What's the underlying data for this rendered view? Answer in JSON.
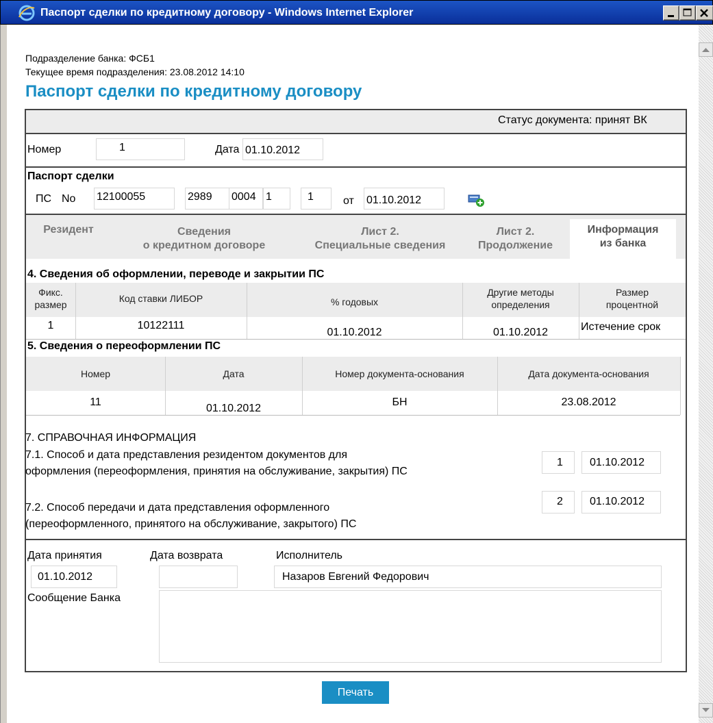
{
  "window": {
    "title": "Паспорт сделки по кредитному договору - Windows Internet Explorer"
  },
  "header": {
    "branch": "Подразделение банка: ФСБ1",
    "time": "Текущее время подразделения: 23.08.2012 14:10",
    "page_title": "Паспорт сделки по кредитному договору"
  },
  "status": "Статус документа: принят ВК",
  "doc": {
    "number_label": "Номер",
    "number": "1",
    "date_label": "Дата",
    "date": "01.10.2012"
  },
  "ps": {
    "heading": "Паспорт сделки",
    "ps_label": "ПС",
    "no_label": "No",
    "part1": "12100055",
    "part2": "2989",
    "part3": "0004",
    "part4": "1",
    "part5": "1",
    "from_label": "от",
    "date": "01.10.2012"
  },
  "tabs": [
    {
      "line1": "Резидент",
      "line2": ""
    },
    {
      "line1": "Сведения",
      "line2": "о кредитном договоре"
    },
    {
      "line1": "Лист 2.",
      "line2": "Специальные сведения"
    },
    {
      "line1": "Лист 2.",
      "line2": "Продолжение"
    },
    {
      "line1": "Информация",
      "line2": "из банка"
    }
  ],
  "section4": {
    "heading": "4. Сведения об оформлении, переводе и закрытии ПС",
    "headers": [
      {
        "line1": "Фикс.",
        "line2": "размер"
      },
      {
        "line1": "Код ставки ЛИБОР",
        "line2": ""
      },
      {
        "line1": "% годовых",
        "line2": ""
      },
      {
        "line1": "Другие методы",
        "line2": "определения"
      },
      {
        "line1": "Размер",
        "line2": "процентной"
      }
    ],
    "row": [
      "1",
      "10122111",
      "01.10.2012",
      "01.10.2012",
      "Истечение срок"
    ]
  },
  "section5": {
    "heading": "5. Сведения о переоформлении ПС",
    "headers": [
      "Номер",
      "Дата",
      "Номер документа-основания",
      "Дата документа-основания"
    ],
    "row": [
      "11",
      "01.10.2012",
      "БН",
      "23.08.2012"
    ]
  },
  "section7": {
    "heading": "7. СПРАВОЧНАЯ ИНФОРМАЦИЯ",
    "item1_line1": "7.1. Способ и дата представления резидентом документов для",
    "item1_line2": "оформления (переоформления, принятия на обслуживание, закрытия) ПС",
    "item1_code": "1",
    "item1_date": "01.10.2012",
    "item2_line1": "7.2. Способ передачи и дата представления оформленного",
    "item2_line2": "(переоформленного, принятого на обслуживание, закрытого) ПС",
    "item2_code": "2",
    "item2_date": "01.10.2012"
  },
  "bottom": {
    "accept_label": "Дата принятия",
    "accept_date": "01.10.2012",
    "return_label": "Дата возврата",
    "return_date": "",
    "executor_label": "Исполнитель",
    "executor": "Назаров Евгений Федорович",
    "message_label": "Сообщение Банка",
    "message": ""
  },
  "print_label": "Печать",
  "icons": {
    "browser": "ie-icon",
    "add_record": "add-record-icon"
  },
  "colors": {
    "accent": "#1a8ec4",
    "titlebar": "#0a2f9a"
  }
}
